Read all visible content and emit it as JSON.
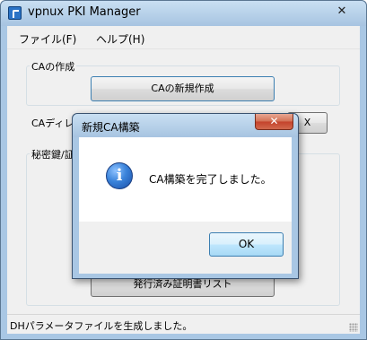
{
  "window": {
    "title": "vpnux PKI Manager",
    "close_glyph": "✕"
  },
  "menu": {
    "items": [
      {
        "label": "ファイル(F)"
      },
      {
        "label": "ヘルプ(H)"
      }
    ]
  },
  "ca_section": {
    "label": "CAの作成",
    "new_ca_button": "CAの新規作成",
    "ca_dir_label": "CAディレ",
    "browse_button_partial": "X"
  },
  "key_section": {
    "label": "秘密鍵/証"
  },
  "issued_list_button": "発行済み証明書リスト",
  "status": {
    "text": "DHパラメータファイルを生成しました。"
  },
  "dialog": {
    "title": "新規CA構築",
    "message": "CA構築を完了しました。",
    "ok_label": "OK",
    "icon_glyph": "i",
    "close_glyph": "✕"
  },
  "colors": {
    "titlebar": "#b9d3ec",
    "client_bg": "#f0f0f0",
    "dialog_close": "#c4412a",
    "info_icon": "#3a83da"
  },
  "icons": [
    "app-icon",
    "close-icon",
    "info-icon",
    "resize-grip-icon"
  ]
}
